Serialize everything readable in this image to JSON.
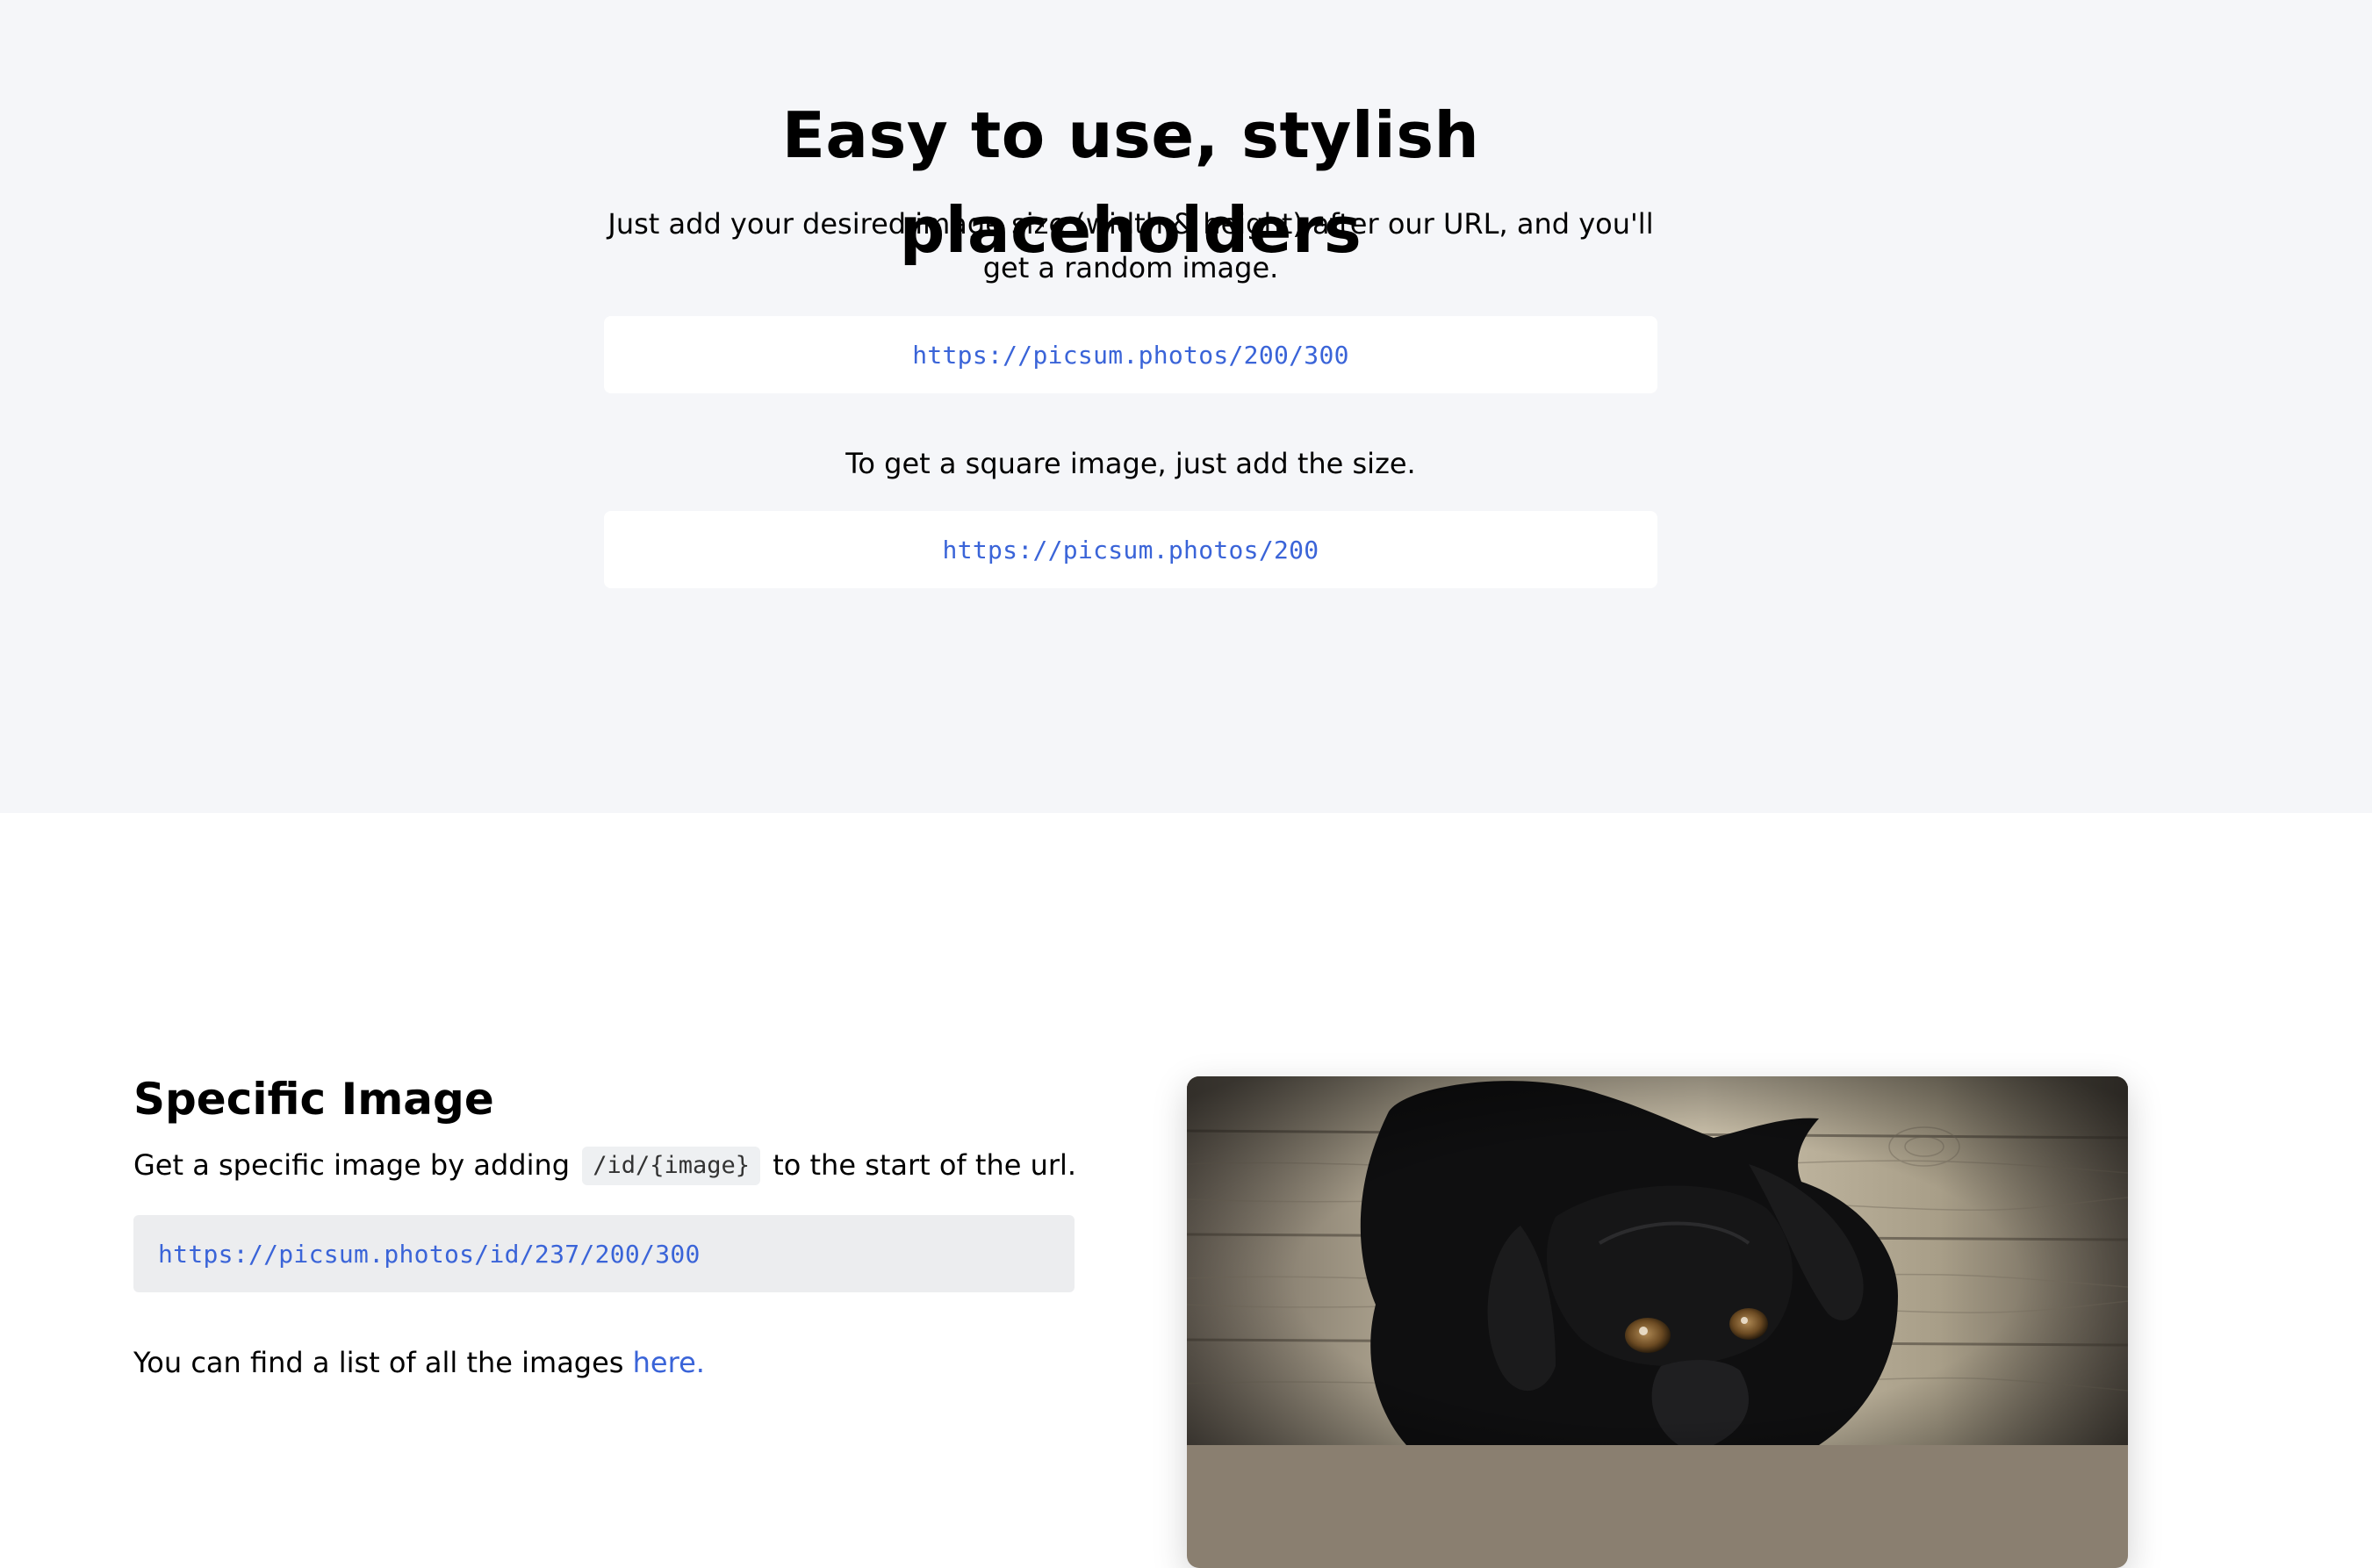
{
  "hero": {
    "title": "Easy to use, stylish placeholders",
    "lead": "Just add your desired image size (width & height) after our URL, and you'll get a random image.",
    "url_random": "https://picsum.photos/200/300",
    "square_text": "To get a square image, just add the size.",
    "url_square": "https://picsum.photos/200"
  },
  "specific": {
    "title": "Specific Image",
    "desc_before": "Get a specific image by adding",
    "desc_code": "/id/{image}",
    "desc_after": "to the start of the url.",
    "url_example": "https://picsum.photos/id/237/200/300",
    "list_text": "You can find a list of all the images",
    "list_link": "here."
  },
  "colors": {
    "hero_bg": "#f5f6f9",
    "link": "#3a64d8",
    "code_bg": "#ecedef"
  }
}
